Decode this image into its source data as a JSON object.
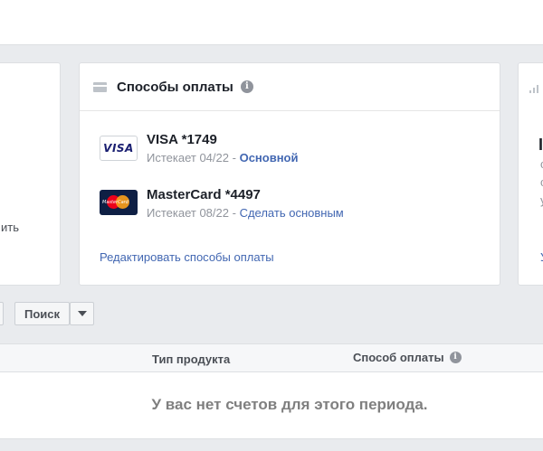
{
  "payment_methods_card": {
    "title": "Способы оплаты",
    "methods": [
      {
        "brand_label": "VISA",
        "name": "VISA *1749",
        "expires": "Истекает 04/22",
        "separator": "-",
        "status": "Основной"
      },
      {
        "brand_label": "MasterCard",
        "name": "MasterCard *4497",
        "expires": "Истекает 08/22",
        "separator": "-",
        "action": "Сделать основным"
      }
    ],
    "edit_link": "Редактировать способы оплаты"
  },
  "left_card": {
    "partial_text": "ить"
  },
  "right_card": {
    "partial_heading": "I",
    "partial_lines": [
      "с",
      "с",
      "у"
    ],
    "partial_link": "У"
  },
  "toolbar": {
    "search_label": "Поиск"
  },
  "table": {
    "columns": [
      "Тип продукта",
      "Способ оплаты"
    ],
    "empty_message": "У вас нет счетов для этого периода."
  },
  "colors": {
    "background": "#e9ebee",
    "link": "#4267b2",
    "muted": "#90949c"
  },
  "icons": {
    "credit_card": "credit-card-icon",
    "info": "info-icon",
    "dropdown": "chevron-down-icon"
  }
}
